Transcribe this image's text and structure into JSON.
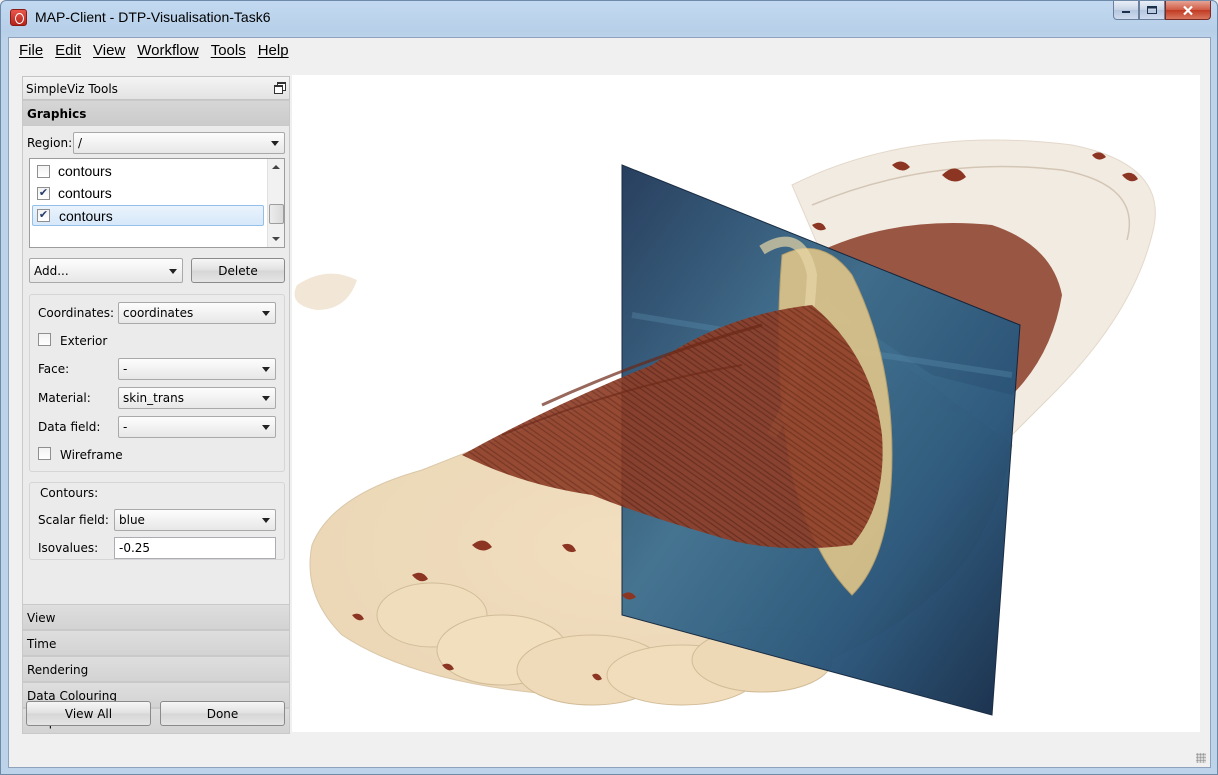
{
  "window": {
    "title": "MAP-Client - DTP-Visualisation-Task6"
  },
  "menu": [
    {
      "label": "File",
      "name": "menu-file"
    },
    {
      "label": "Edit",
      "name": "menu-edit"
    },
    {
      "label": "View",
      "name": "menu-view"
    },
    {
      "label": "Workflow",
      "name": "menu-workflow"
    },
    {
      "label": "Tools",
      "name": "menu-tools"
    },
    {
      "label": "Help",
      "name": "menu-help"
    }
  ],
  "dock": {
    "title": "SimpleViz Tools",
    "sections": {
      "graphics": "Graphics",
      "view": "View",
      "time": "Time",
      "rendering": "Rendering",
      "data_colouring": "Data Colouring",
      "output": "Output"
    },
    "region": {
      "label": "Region:",
      "value": "/"
    },
    "graphics_list": [
      {
        "label": "contours",
        "checked": false,
        "selected": false
      },
      {
        "label": "contours",
        "checked": true,
        "selected": false
      },
      {
        "label": "contours",
        "checked": true,
        "selected": true
      }
    ],
    "add_label": "Add...",
    "delete_label": "Delete",
    "coordinates": {
      "label": "Coordinates:",
      "value": "coordinates"
    },
    "exterior": {
      "label": "Exterior",
      "checked": false
    },
    "face": {
      "label": "Face:",
      "value": "-"
    },
    "material": {
      "label": "Material:",
      "value": "skin_trans"
    },
    "data_field": {
      "label": "Data field:",
      "value": "-"
    },
    "wireframe": {
      "label": "Wireframe",
      "checked": false
    },
    "contours": {
      "title": "Contours:",
      "scalar_field": {
        "label": "Scalar field:",
        "value": "blue"
      },
      "isovalues": {
        "label": "Isovalues:",
        "value": "-0.25"
      }
    },
    "view_all_label": "View All",
    "done_label": "Done"
  },
  "colors": {
    "skin": "#eed9b8",
    "muscle": "#8a3a25",
    "bone": "#d9c08a",
    "slice": "#23466b",
    "selection": "#d7e8fa"
  }
}
